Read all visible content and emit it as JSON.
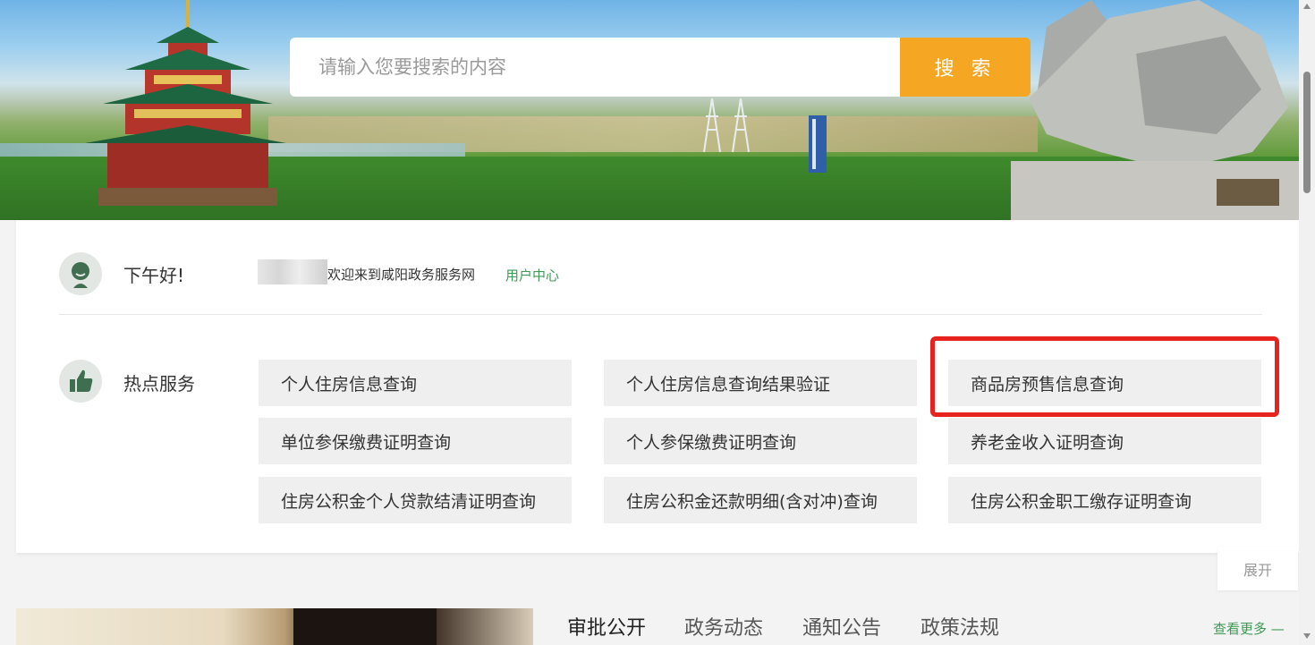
{
  "search": {
    "placeholder": "请输入您要搜索的内容",
    "button_label": "搜 索"
  },
  "user": {
    "greeting": "下午好!",
    "welcome_text": "欢迎来到咸阳政务服务网",
    "user_center_label": "用户中心"
  },
  "hot_services": {
    "title": "热点服务",
    "items": [
      "个人住房信息查询",
      "个人住房信息查询结果验证",
      "商品房预售信息查询",
      "单位参保缴费证明查询",
      "个人参保缴费证明查询",
      "养老金收入证明查询",
      "住房公积金个人贷款结清证明查询",
      "住房公积金还款明细(含对冲)查询",
      "住房公积金职工缴存证明查询"
    ],
    "highlighted_item": "商品房预售信息查询"
  },
  "expand_label": "展开",
  "news": {
    "tabs": [
      "审批公开",
      "政务动态",
      "通知公告",
      "政策法规"
    ],
    "active_tab": "审批公开",
    "more_label": "查看更多 —"
  },
  "colors": {
    "accent_orange": "#f5a623",
    "link_green": "#3d9a55",
    "highlight_red": "#e8231f"
  }
}
